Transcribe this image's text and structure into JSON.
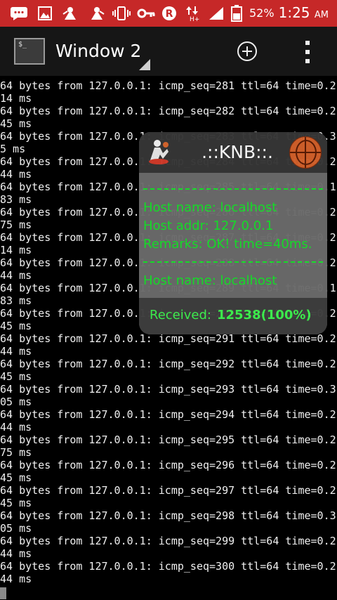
{
  "status_bar": {
    "battery_percent": "52%",
    "time": "1:25",
    "meridiem": "AM",
    "icons": [
      "message-icon",
      "gallery-icon",
      "app-icon-1",
      "app-icon-2",
      "vibrate-icon",
      "key-icon",
      "r-icon",
      "data-arrows-icon",
      "signal-icon",
      "battery-icon"
    ]
  },
  "app_bar": {
    "title": "Window 2",
    "add_icon": "plus-circle-icon",
    "menu_icon": "overflow-menu-icon"
  },
  "terminal": {
    "lines": [
      "64 bytes from 127.0.0.1: icmp_seq=281 ttl=64 time=0.2",
      "14 ms",
      "64 bytes from 127.0.0.1: icmp_seq=282 ttl=64 time=0.2",
      "45 ms",
      "64 bytes from 127.0.0.1: icmp_seq=283 ttl=64 time=0.3",
      "5 ms",
      "64 bytes from 127.0.0.1: icmp_seq=284 ttl=64 time=0.2",
      "44 ms",
      "64 bytes from 127.0.0.1: icmp_seq=285 ttl=64 time=0.1",
      "83 ms",
      "64 bytes from 127.0.0.1: icmp_seq=286 ttl=64 time=0.2",
      "75 ms",
      "64 bytes from 127.0.0.1: icmp_seq=287 ttl=64 time=0.2",
      "14 ms",
      "64 bytes from 127.0.0.1: icmp_seq=288 ttl=64 time=0.2",
      "44 ms",
      "64 bytes from 127.0.0.1: icmp_seq=289 ttl=64 time=0.1",
      "83 ms",
      "64 bytes from 127.0.0.1: icmp_seq=290 ttl=64 time=0.2",
      "45 ms",
      "64 bytes from 127.0.0.1: icmp_seq=291 ttl=64 time=0.2",
      "44 ms",
      "64 bytes from 127.0.0.1: icmp_seq=292 ttl=64 time=0.2",
      "45 ms",
      "64 bytes from 127.0.0.1: icmp_seq=293 ttl=64 time=0.3",
      "05 ms",
      "64 bytes from 127.0.0.1: icmp_seq=294 ttl=64 time=0.2",
      "44 ms",
      "64 bytes from 127.0.0.1: icmp_seq=295 ttl=64 time=0.2",
      "75 ms",
      "64 bytes from 127.0.0.1: icmp_seq=296 ttl=64 time=0.2",
      "45 ms",
      "64 bytes from 127.0.0.1: icmp_seq=297 ttl=64 time=0.2",
      "45 ms",
      "64 bytes from 127.0.0.1: icmp_seq=298 ttl=64 time=0.3",
      "05 ms",
      "64 bytes from 127.0.0.1: icmp_seq=299 ttl=64 time=0.2",
      "44 ms",
      "64 bytes from 127.0.0.1: icmp_seq=300 ttl=64 time=0.2",
      "44 ms"
    ]
  },
  "knb_widget": {
    "title": ".::KNB::.",
    "entries": [
      "Host name: localhost",
      "Host addr: 127.0.0.1",
      "Remarks: OK! time=40ms.",
      "Host name: localhost"
    ],
    "received_label": "Received:",
    "received_value": "12538(100%)"
  },
  "colors": {
    "status_bar": "#c62828",
    "app_bar": "#161616",
    "terminal_bg": "#000000",
    "terminal_text": "#f0f0f0",
    "widget_text": "#16e22a"
  }
}
